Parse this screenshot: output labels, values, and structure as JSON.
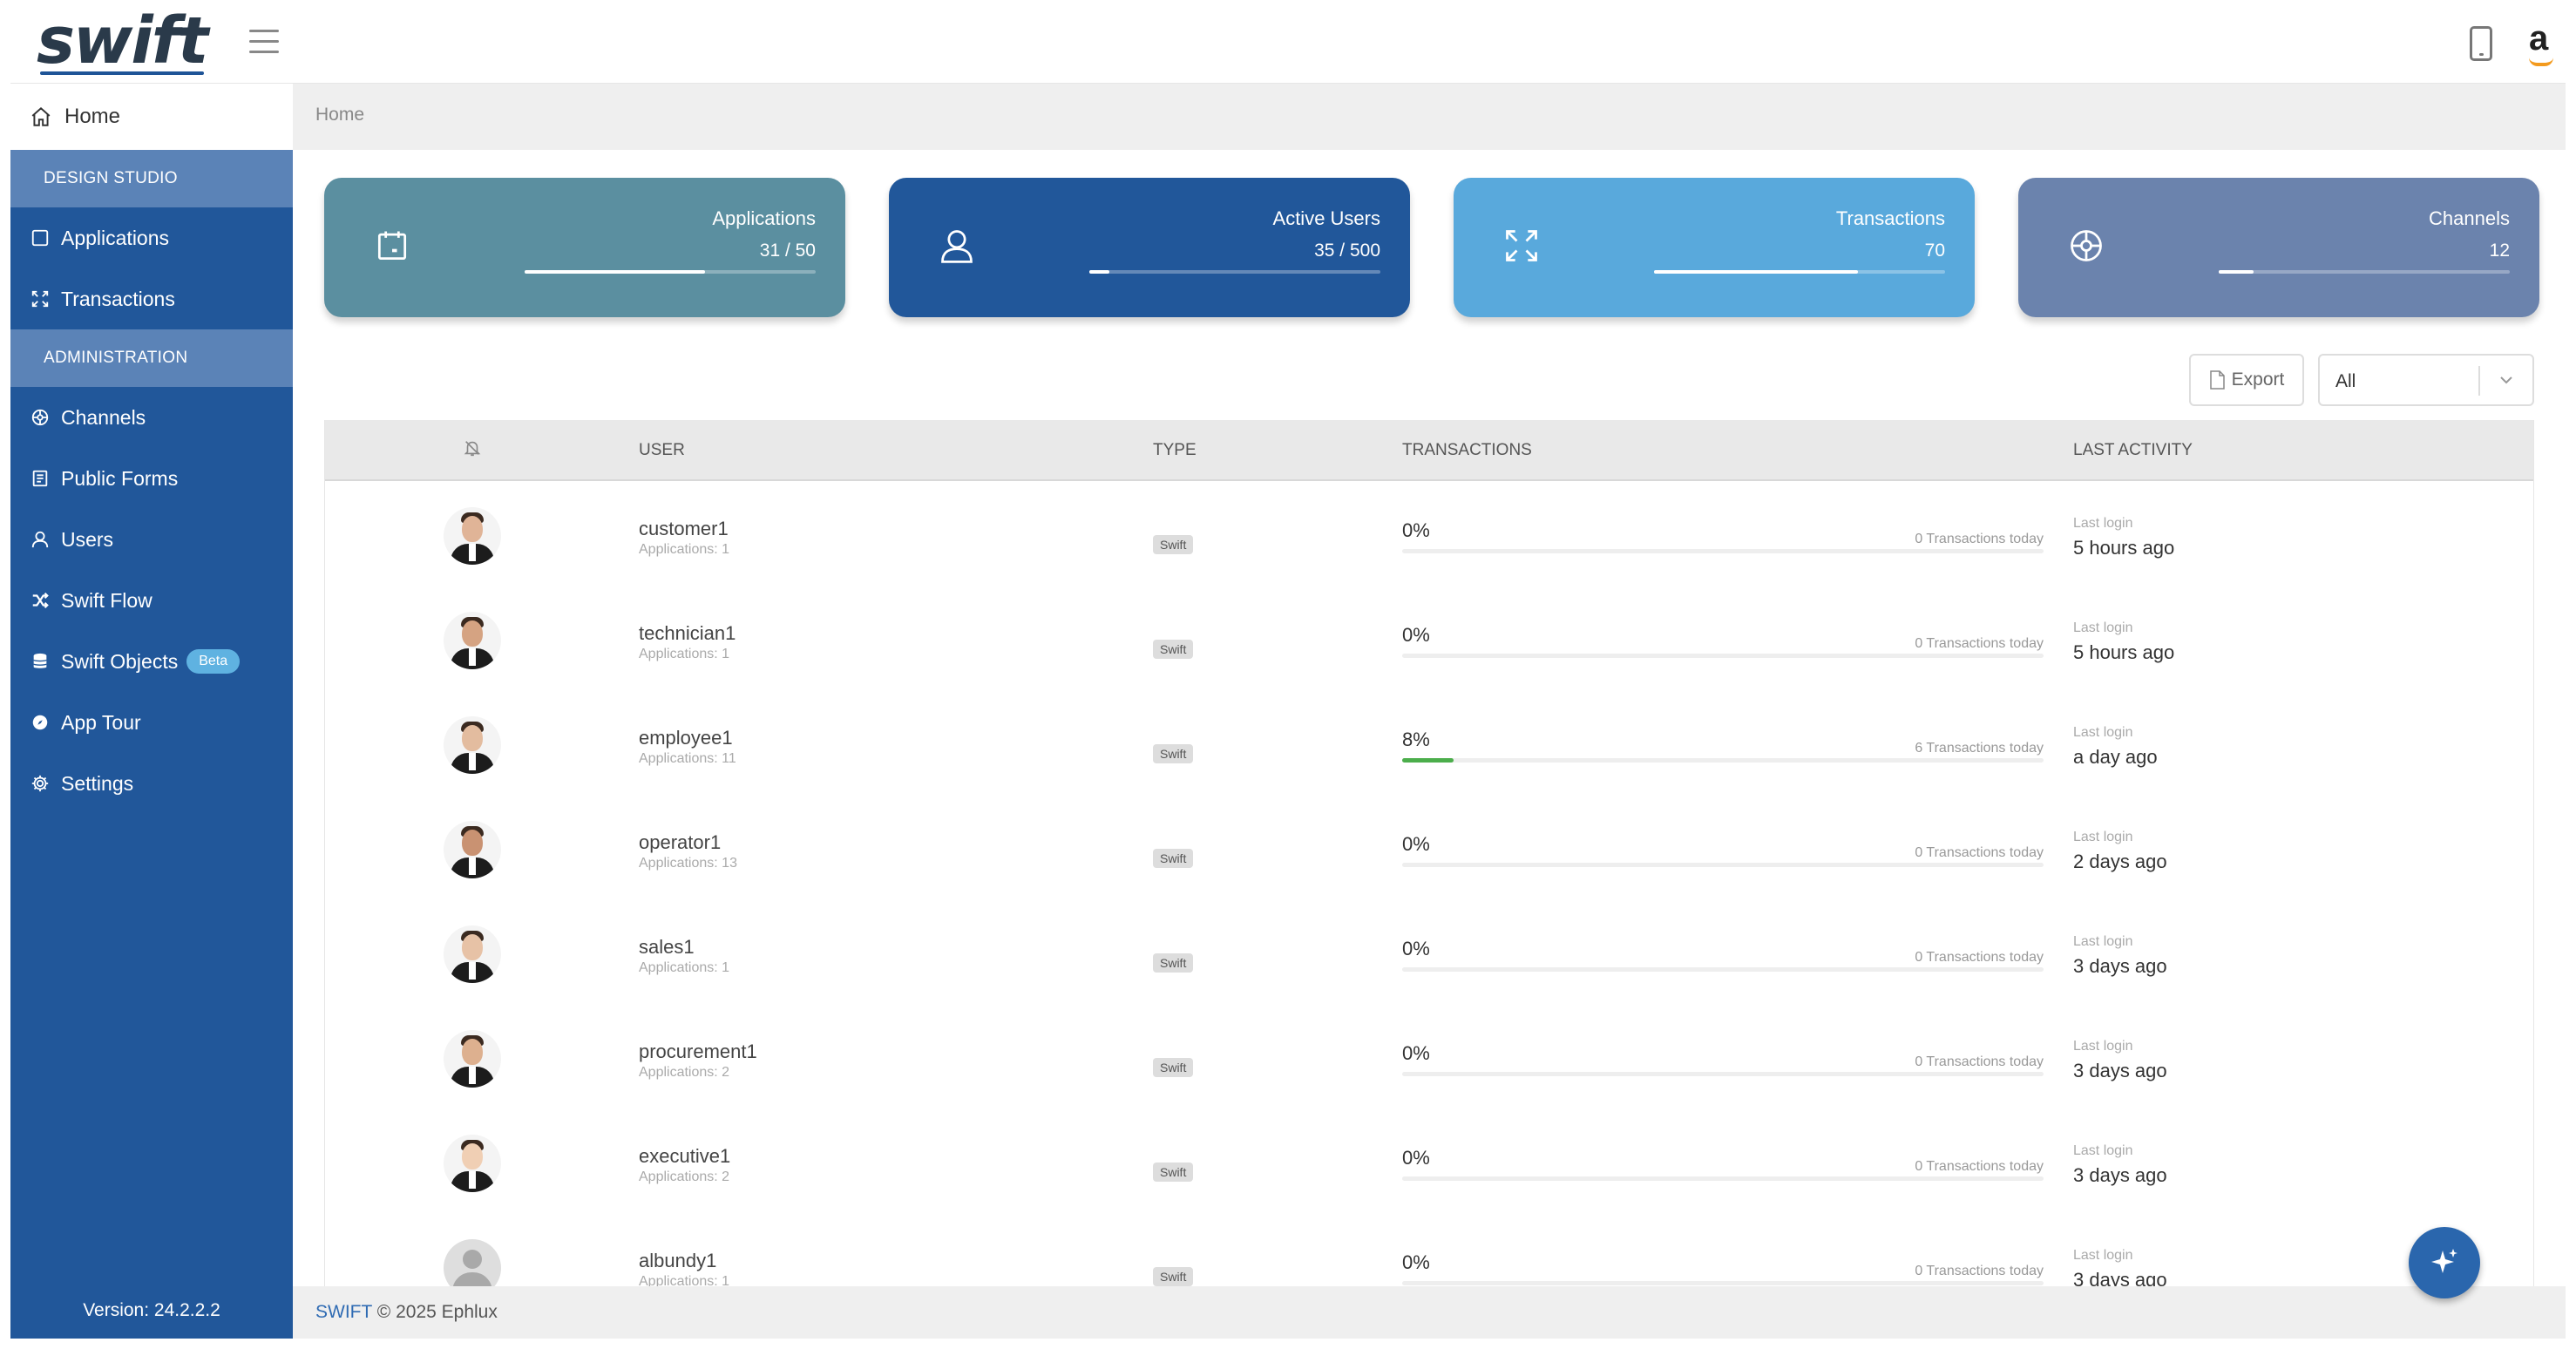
{
  "header": {
    "logo": "swift",
    "icons": [
      "menu-icon",
      "mobile-icon",
      "amazon-icon"
    ]
  },
  "sidebar": {
    "home": "Home",
    "sections": [
      {
        "title": "DESIGN STUDIO",
        "items": [
          {
            "label": "Applications",
            "icon": "applications-icon"
          },
          {
            "label": "Transactions",
            "icon": "transactions-icon"
          }
        ]
      },
      {
        "title": "ADMINISTRATION",
        "items": [
          {
            "label": "Channels",
            "icon": "channels-icon"
          },
          {
            "label": "Public Forms",
            "icon": "forms-icon"
          },
          {
            "label": "Users",
            "icon": "users-icon"
          },
          {
            "label": "Swift Flow",
            "icon": "flow-icon"
          },
          {
            "label": "Swift Objects",
            "icon": "database-icon",
            "badge": "Beta"
          },
          {
            "label": "App Tour",
            "icon": "tour-icon"
          },
          {
            "label": "Settings",
            "icon": "settings-icon"
          }
        ]
      }
    ],
    "version": "Version: 24.2.2.2"
  },
  "breadcrumb": "Home",
  "cards": [
    {
      "label": "Applications",
      "value": "31 / 50",
      "progress": 0.62,
      "color": "#5b8fa0",
      "icon": "calendar-icon"
    },
    {
      "label": "Active Users",
      "value": "35 / 500",
      "progress": 0.07,
      "color": "#21579a",
      "icon": "user-icon"
    },
    {
      "label": "Transactions",
      "value": "70",
      "progress": 0.7,
      "color": "#59a9dc",
      "icon": "expand-icon"
    },
    {
      "label": "Channels",
      "value": "12",
      "progress": 0.12,
      "color": "#6b83ad",
      "icon": "channels-icon"
    }
  ],
  "toolbar": {
    "export": "Export",
    "filter": "All"
  },
  "table": {
    "columns": {
      "user": "USER",
      "type": "TYPE",
      "transactions": "TRANSACTIONS",
      "last_activity": "LAST ACTIVITY"
    },
    "rows": [
      {
        "user": "customer1",
        "apps": "Applications: 1",
        "type": "Swift",
        "pct": "0%",
        "today": "0 Transactions today",
        "progress": 0,
        "last_label": "Last login",
        "last": "5 hours ago",
        "avatar": "person-icon"
      },
      {
        "user": "technician1",
        "apps": "Applications: 1",
        "type": "Swift",
        "pct": "0%",
        "today": "0 Transactions today",
        "progress": 0,
        "last_label": "Last login",
        "last": "5 hours ago",
        "avatar": "person-icon"
      },
      {
        "user": "employee1",
        "apps": "Applications: 11",
        "type": "Swift",
        "pct": "8%",
        "today": "6 Transactions today",
        "progress": 0.08,
        "last_label": "Last login",
        "last": "a day ago",
        "avatar": "person-icon"
      },
      {
        "user": "operator1",
        "apps": "Applications: 13",
        "type": "Swift",
        "pct": "0%",
        "today": "0 Transactions today",
        "progress": 0,
        "last_label": "Last login",
        "last": "2 days ago",
        "avatar": "person-icon"
      },
      {
        "user": "sales1",
        "apps": "Applications: 1",
        "type": "Swift",
        "pct": "0%",
        "today": "0 Transactions today",
        "progress": 0,
        "last_label": "Last login",
        "last": "3 days ago",
        "avatar": "person-icon"
      },
      {
        "user": "procurement1",
        "apps": "Applications: 2",
        "type": "Swift",
        "pct": "0%",
        "today": "0 Transactions today",
        "progress": 0,
        "last_label": "Last login",
        "last": "3 days ago",
        "avatar": "person-icon"
      },
      {
        "user": "executive1",
        "apps": "Applications: 2",
        "type": "Swift",
        "pct": "0%",
        "today": "0 Transactions today",
        "progress": 0,
        "last_label": "Last login",
        "last": "3 days ago",
        "avatar": "person-icon"
      },
      {
        "user": "albundy1",
        "apps": "Applications: 1",
        "type": "Swift",
        "pct": "0%",
        "today": "0 Transactions today",
        "progress": 0,
        "last_label": "Last login",
        "last": "3 days ago",
        "avatar": "default-avatar-icon"
      }
    ]
  },
  "footer": {
    "brand": "SWIFT",
    "rest": "© 2025 Ephlux"
  },
  "fab": {
    "icon": "sparkle-icon"
  }
}
